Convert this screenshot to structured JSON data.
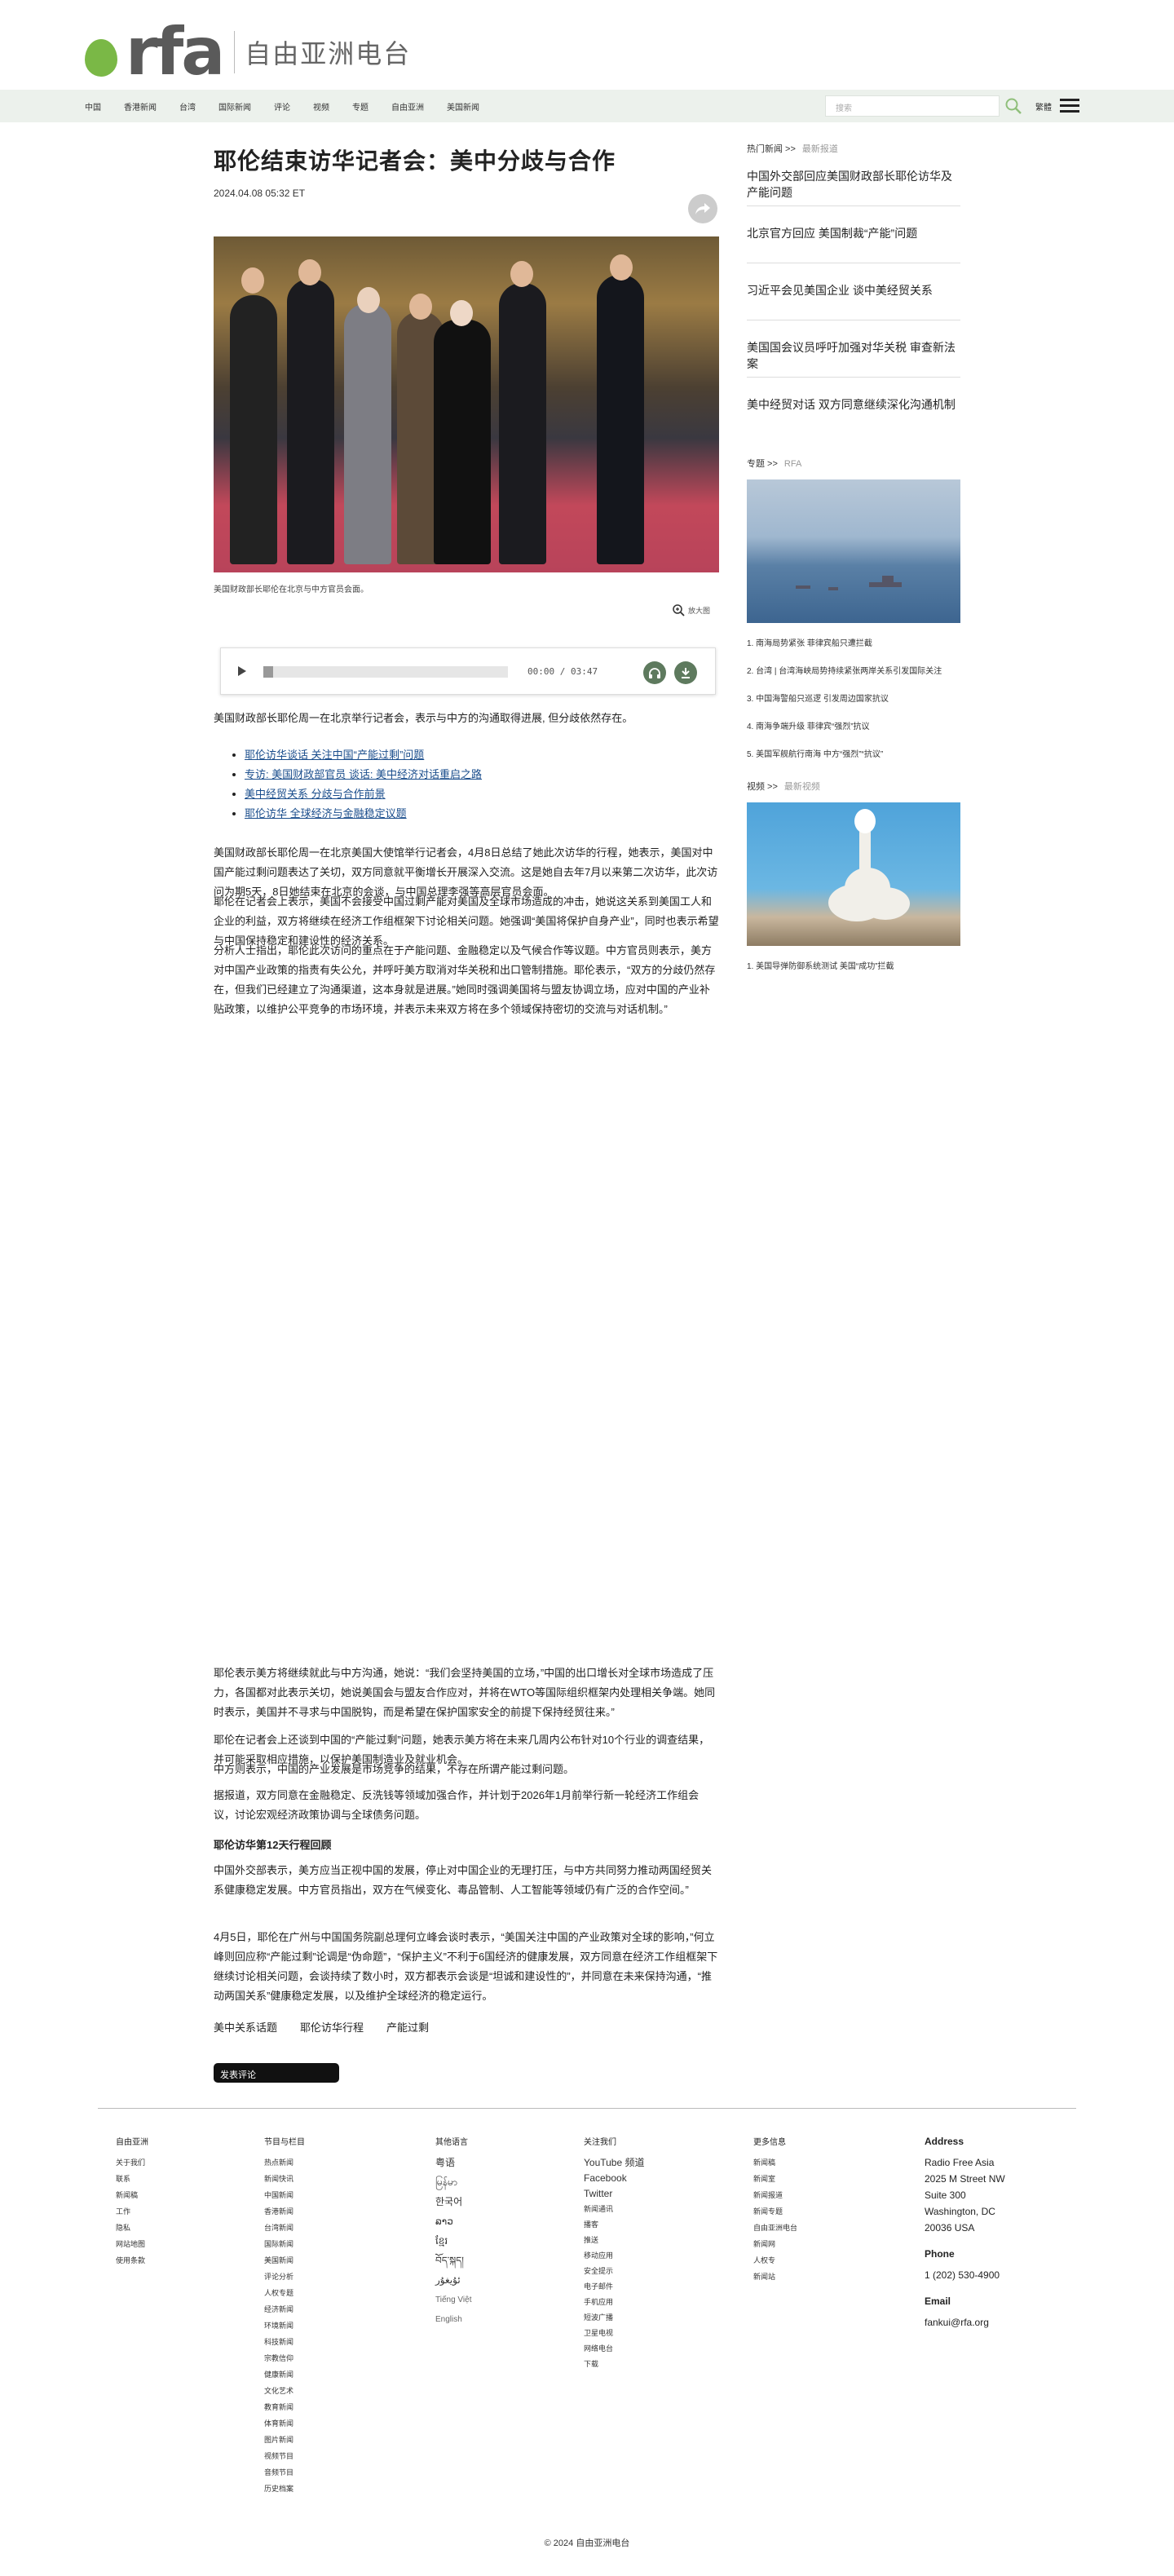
{
  "brand": {
    "logo_text": "rfa",
    "name": "自由亚洲电台",
    "accent": "#7ab846"
  },
  "nav": {
    "items": [
      "中国",
      "香港新闻",
      "台湾",
      "国际新闻",
      "评论",
      "视频",
      "专题",
      "自由亚洲",
      "美国新闻"
    ],
    "search_placeholder": "搜索",
    "lang_toggle": "繁體"
  },
  "article": {
    "headline": "耶伦结束访华记者会：美中分歧与合作",
    "date": "2024.04.08 05:32 ET",
    "caption": "美国财政部长耶伦在北京与中方官员会面。",
    "zoom_label": "放大图",
    "audio": {
      "time": "00:00 / 03:47",
      "progress": 0.04
    },
    "lead": "美国财政部长耶伦周一在北京举行记者会，表示与中方的沟通取得进展, 但分歧依然存在。",
    "related": [
      "耶伦访华谈话 关注中国“产能过剩”问题",
      "专访: 美国财政部官员 谈话: 美中经济对话重启之路",
      "美中经贸关系 分歧与合作前景",
      "耶伦访华 全球经济与金融稳定议题"
    ],
    "paragraphs": [
      "美国财政部长耶伦周一在北京美国大使馆举行记者会，4月8日总结了她此次访华的行程，她表示，美国对中国产能过剩问题表达了关切，双方同意就平衡增长开展深入交流。这是她自去年7月以来第二次访华，此次访问为期5天，8日她结束在北京的会谈，与中国总理李强等高层官员会面。",
      "耶伦在记者会上表示，美国不会接受中国过剩产能对美国及全球市场造成的冲击，她说这关系到美国工人和企业的利益，双方将继续在经济工作组框架下讨论相关问题。她强调“美国将保护自身产业”，同时也表示希望与中国保持稳定和建设性的经济关系。",
      "分析人士指出，耶伦此次访问的重点在于产能问题、金融稳定以及气候合作等议题。中方官员则表示，美方对中国产业政策的指责有失公允，并呼吁美方取消对华关税和出口管制措施。耶伦表示，“双方的分歧仍然存在，但我们已经建立了沟通渠道，这本身就是进展。”她同时强调美国将与盟友协调立场，应对中国的产业补贴政策，以维护公平竞争的市场环境，并表示未来双方将在多个领域保持密切的交流与对话机制。”",
      "耶伦表示美方将继续就此与中方沟通，她说：“我们会坚持美国的立场，”中国的出口增长对全球市场造成了压力，各国都对此表示关切，她说美国会与盟友合作应对，并将在WTO等国际组织框架内处理相关争端。她同时表示，美国并不寻求与中国脱钩，而是希望在保护国家安全的前提下保持经贸往来。”",
      "耶伦在记者会上还谈到中国的“产能过剩”问题，她表示美方将在未来几周内公布针对10个行业的调查结果，并可能采取相应措施，以保护美国制造业及就业机会。",
      "中方则表示，中国的产业发展是市场竞争的结果，不存在所谓产能过剩问题。",
      "据报道，双方同意在金融稳定、反洗钱等领域加强合作，并计划于2026年1月前举行新一轮经济工作组会议，讨论宏观经济政策协调与全球债务问题。",
      "中国外交部表示，美方应当正视中国的发展，停止对中国企业的无理打压，与中方共同努力推动两国经贸关系健康稳定发展。中方官员指出，双方在气候变化、毒品管制、人工智能等领域仍有广泛的合作空间。”",
      "4月5日，耶伦在广州与中国国务院副总理何立峰会谈时表示，“美国关注中国的产业政策对全球的影响，”何立峰则回应称“产能过剩”论调是“伪命题”，“保护主义”不利于6国经济的健康发展，双方同意在经济工作组框架下继续讨论相关问题，会谈持续了数小时，双方都表示会谈是“坦诚和建设性的”，并同意在未来保持沟通，“推动两国关系”健康稳定发展，以及维护全球经济的稳定运行。"
    ],
    "subhead": "耶伦访华第12天行程回顾",
    "tags": [
      "美中关系话题",
      "耶伦访华行程",
      "产能过剩"
    ],
    "comments_label": "发表评论"
  },
  "sidebar": {
    "section1": {
      "title": "热门新闻 >>",
      "label": "最新报道"
    },
    "top_stories": [
      "中国外交部回应美国财政部长耶伦访华及产能问题",
      "北京官方回应 美国制裁“产能”问题",
      "习近平会见美国企业 谈中美经贸关系",
      "美国国会议员呼吁加强对华关税 审查新法案",
      "美中经贸对话 双方同意继续深化沟通机制"
    ],
    "section2": {
      "title": "专题 >>",
      "label": "RFA"
    },
    "list2": [
      "1. 南海局势紧张 菲律宾船只遭拦截",
      "2. 台湾 | 台湾海峡局势持续紧张两岸关系引发国际关注",
      "3. 中国海警船只巡逻 引发周边国家抗议",
      "4. 南海争端升级 菲律宾“强烈”抗议",
      "5. 美国军舰航行南海 中方“强烈”“抗议”"
    ],
    "section3": {
      "title": "视频 >>",
      "label": "最新视频"
    },
    "list3": [
      "1. 美国导弹防御系统测试 美国“成功”拦截"
    ]
  },
  "footer": {
    "col1": {
      "title": "自由亚洲",
      "items": [
        "关于我们",
        "联系",
        "新闻稿",
        "工作",
        "隐私",
        "网站地图",
        "使用条款"
      ]
    },
    "col2": {
      "title": "节目与栏目",
      "items": [
        "热点新闻",
        "新闻快讯",
        "中国新闻",
        "香港新闻",
        "台湾新闻",
        "国际新闻",
        "美国新闻",
        "评论分析",
        "人权专题",
        "经济新闻",
        "环境新闻",
        "科技新闻",
        "宗教信仰",
        "健康新闻",
        "文化艺术",
        "教育新闻",
        "体育新闻",
        "图片新闻",
        "视频节目",
        "音频节目",
        "历史档案"
      ]
    },
    "col3": {
      "title": "其他语言",
      "items": [
        "粤语",
        "မြန်မာ",
        "한국어",
        "ລາວ",
        "ខ្មែរ",
        "བོད་སྐད།",
        "ئۇيغۇر",
        "Tiếng Việt",
        "English"
      ]
    },
    "col4": {
      "title": "关注我们",
      "items": [
        "YouTube 频道",
        "Facebook",
        "Twitter",
        "新闻通讯",
        "播客",
        "推送",
        "移动应用",
        "安全提示",
        "电子邮件",
        "手机应用",
        "短波广播",
        "卫星电视",
        "网络电台",
        "下载"
      ]
    },
    "col5": {
      "title": "更多信息",
      "items": [
        "新闻稿",
        "新闻室",
        "新闻报道",
        "新闻专题",
        "自由亚洲电台",
        "新闻网",
        "人权专",
        "新闻站"
      ]
    },
    "address": {
      "title": "Address",
      "lines": [
        "Radio Free Asia",
        "2025 M Street NW",
        "Suite 300",
        "Washington, DC",
        "20036 USA"
      ],
      "phone_title": "Phone",
      "phone": "1 (202) 530-4900",
      "email_title": "Email",
      "email": "fankui@rfa.org"
    },
    "copyright": "© 2024 自由亚洲电台"
  }
}
